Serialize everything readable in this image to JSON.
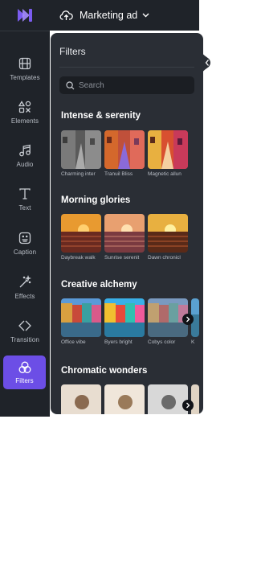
{
  "app": {
    "project_title": "Marketing ad"
  },
  "sidebar": {
    "items": [
      {
        "label": "Templates",
        "icon": "film-icon"
      },
      {
        "label": "Elements",
        "icon": "shapes-icon"
      },
      {
        "label": "Audio",
        "icon": "music-note-icon"
      },
      {
        "label": "Text",
        "icon": "text-t-icon"
      },
      {
        "label": "Caption",
        "icon": "caption-icon"
      },
      {
        "label": "Effects",
        "icon": "magic-wand-icon"
      },
      {
        "label": "Transition",
        "icon": "transition-icon"
      },
      {
        "label": "Filters",
        "icon": "filters-icon",
        "active": true
      }
    ]
  },
  "panel": {
    "title": "Filters",
    "search_placeholder": "Search",
    "sections": [
      {
        "title": "Intense & serenity",
        "items": [
          "Charming inter",
          "Tranuil Bliss",
          "Magnetic allun"
        ]
      },
      {
        "title": "Morning glories",
        "items": [
          "Daybreak walk",
          "Sunrise serenit",
          "Dawn chronicl"
        ]
      },
      {
        "title": "Creative alchemy",
        "items": [
          "Office vibe",
          "Byers bright",
          "Cobys color",
          "K"
        ]
      },
      {
        "title": "Chromatic wonders",
        "items": [
          "",
          "",
          "",
          ""
        ]
      }
    ]
  },
  "colors": {
    "accent": "#6c4ee6",
    "rail": "#1f2329",
    "panel": "#2a2e35"
  }
}
